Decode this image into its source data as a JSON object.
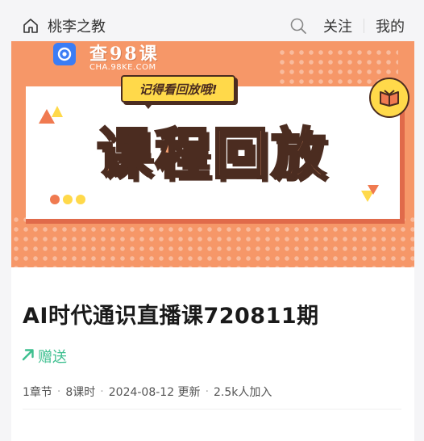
{
  "header": {
    "home_label": "桃李之教",
    "follow_label": "关注",
    "mine_label": "我的"
  },
  "banner": {
    "logo_text": "查98课",
    "logo_sub": "CHA.98KE.COM",
    "tag_text": "记得看回放哦!",
    "title": "课程回放"
  },
  "course": {
    "title": "AI时代通识直播课720811期",
    "gift_label": "赠送",
    "meta": {
      "chapters": "1章节",
      "lessons": "8课时",
      "date_updated": "2024-08-12 更新",
      "joined": "2.5k人加入",
      "separator": "·"
    }
  },
  "colors": {
    "banner_bg": "#f69768",
    "accent_green": "#3dbf8f",
    "tag_yellow": "#ffd94a",
    "ink": "#4b2c20"
  }
}
